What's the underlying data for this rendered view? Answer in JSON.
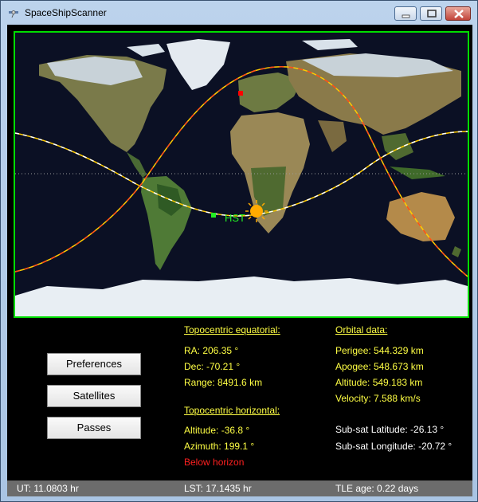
{
  "window": {
    "title": "SpaceShipScanner"
  },
  "map": {
    "satellite_label": "HST"
  },
  "buttons": {
    "preferences": "Preferences",
    "satellites": "Satellites",
    "passes": "Passes"
  },
  "topocentric_equatorial": {
    "header": "Topocentric equatorial:",
    "ra": "RA: 206.35 °",
    "dec": "Dec: -70.21 °",
    "range": "Range: 8491.6 km"
  },
  "topocentric_horizontal": {
    "header": "Topocentric horizontal:",
    "altitude": "Altitude: -36.8 °",
    "azimuth": "Azimuth: 199.1 °",
    "status": "Below horizon"
  },
  "orbital_data": {
    "header": "Orbital data:",
    "perigee": "Perigee: 544.329 km",
    "apogee": "Apogee: 548.673 km",
    "altitude": "Altitude: 549.183 km",
    "velocity": "Velocity: 7.588 km/s",
    "subsat_lat": "Sub-sat Latitude: -26.13 °",
    "subsat_lon": "Sub-sat Longitude: -20.72 °"
  },
  "status_bar": {
    "ut": "UT: 11.0803 hr",
    "lst": "LST: 17.1435 hr",
    "tle_age": "TLE age: 0.22 days"
  },
  "colors": {
    "frame": "#00dd00",
    "value_text": "#ffff44",
    "warning": "#ff2020",
    "satellite": "#22ee22",
    "sun": "#ffaa00",
    "ground_station": "#ff0000"
  }
}
